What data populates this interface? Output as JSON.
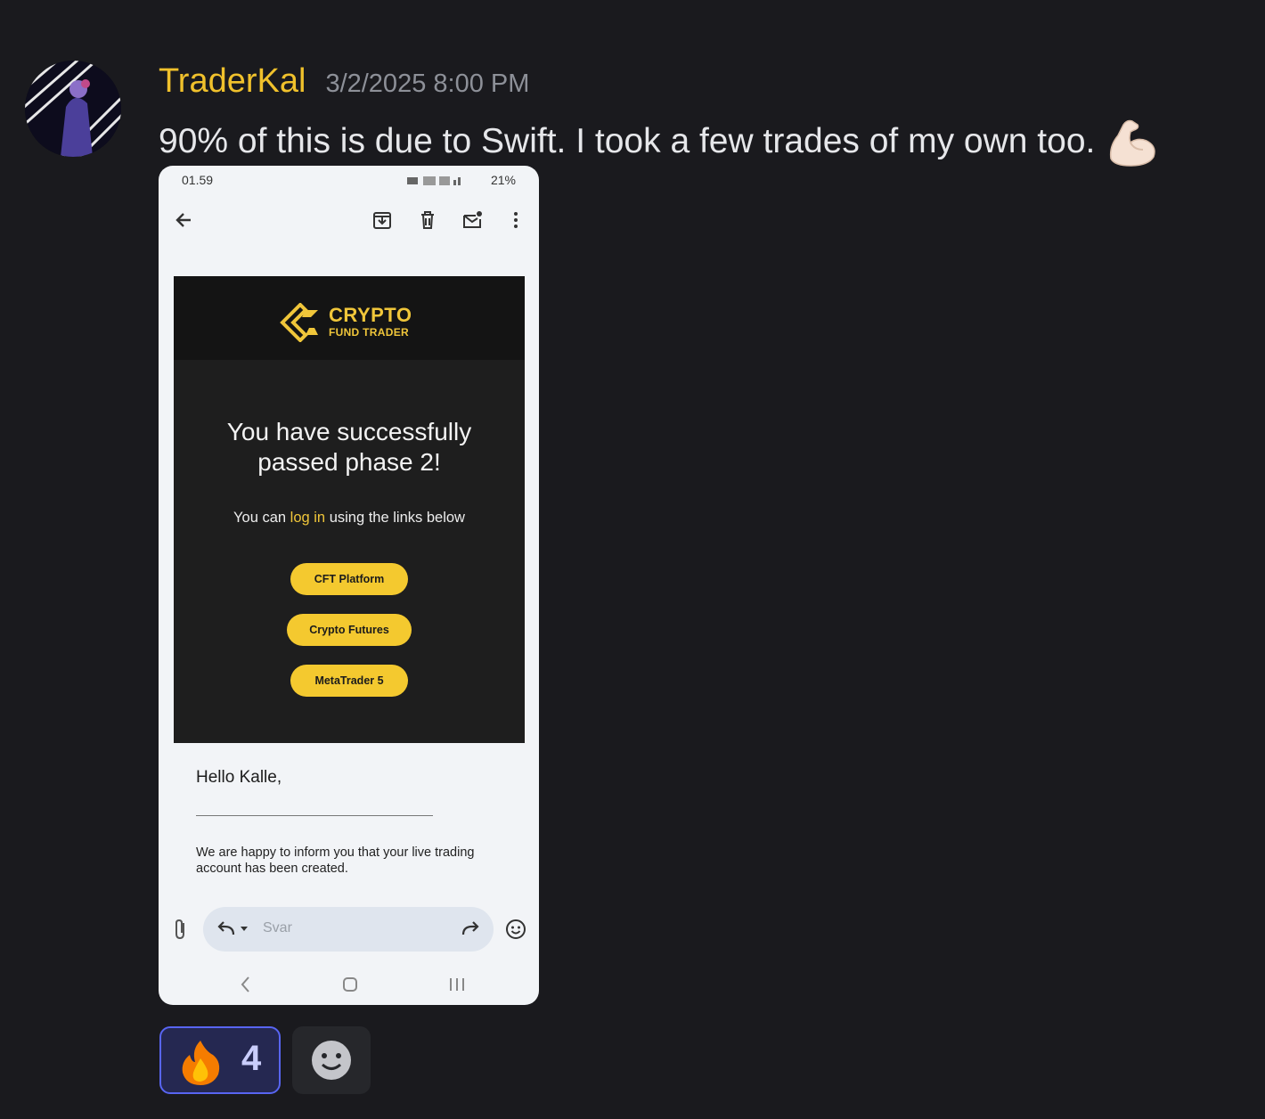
{
  "message": {
    "username": "TraderKal",
    "timestamp": "3/2/2025 8:00 PM",
    "text": "90% of this is due to Swift. I took a few trades of my own too.",
    "emoji": "flexed-biceps-emoji"
  },
  "screenshot": {
    "statusbar": {
      "time": "01.59",
      "right": "21%"
    },
    "brand": {
      "line1": "CRYPTO",
      "line2": "FUND TRADER"
    },
    "headline_line1": "You have successfully",
    "headline_line2": "passed phase 2!",
    "sub_before": "You can ",
    "sub_link": "log in",
    "sub_after": " using the links below",
    "buttons": [
      "CFT Platform",
      "Crypto Futures",
      "MetaTrader 5"
    ],
    "greeting": "Hello Kalle,",
    "body": "We are happy to inform you that your live trading account has been created.",
    "reply_placeholder": "Svar"
  },
  "reactions": [
    {
      "emoji": "fire-emoji",
      "count": "4"
    }
  ],
  "colors": {
    "username": "#f0c12c",
    "brand_yellow": "#f4c92f",
    "reaction_border": "#5865f2"
  }
}
